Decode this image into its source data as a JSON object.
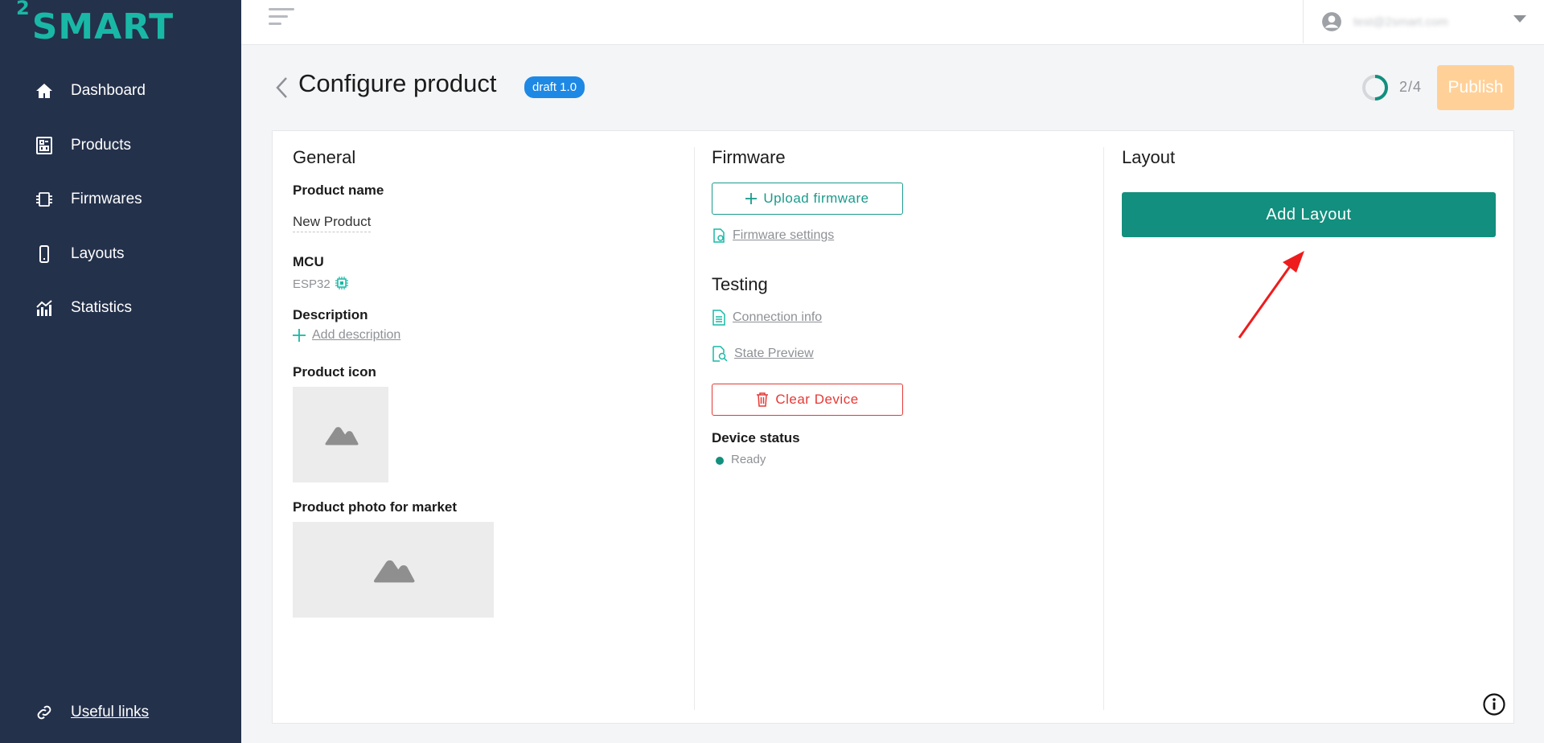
{
  "app": {
    "logo_prefix": "2",
    "logo_text": "SMART"
  },
  "sidebar": {
    "items": [
      {
        "label": "Dashboard",
        "icon": "home-icon"
      },
      {
        "label": "Products",
        "icon": "products-icon"
      },
      {
        "label": "Firmwares",
        "icon": "chip-icon"
      },
      {
        "label": "Layouts",
        "icon": "phone-icon"
      },
      {
        "label": "Statistics",
        "icon": "statistics-icon"
      }
    ],
    "useful_links": "Useful links"
  },
  "topbar": {
    "user_email": "test@2smart.com"
  },
  "header": {
    "title": "Configure product",
    "badge": "draft 1.0",
    "progress_text": "2/4",
    "progress_fraction": 0.5,
    "publish_label": "Publish"
  },
  "general": {
    "title": "General",
    "product_name_label": "Product name",
    "product_name_value": "New Product",
    "mcu_label": "MCU",
    "mcu_value": "ESP32",
    "description_label": "Description",
    "add_description": "Add description",
    "product_icon_label": "Product icon",
    "product_photo_label": "Product photo for market"
  },
  "firmware": {
    "title": "Firmware",
    "upload_label": "Upload firmware",
    "settings_link": "Firmware settings"
  },
  "testing": {
    "title": "Testing",
    "connection_info": "Connection info",
    "state_preview": "State Preview",
    "clear_device": "Clear Device",
    "device_status_label": "Device status",
    "device_status_value": "Ready"
  },
  "layout": {
    "title": "Layout",
    "add_layout_label": "Add Layout"
  },
  "colors": {
    "sidebar_bg": "#24314b",
    "accent_teal": "#128f7e",
    "badge_blue": "#1e88e5",
    "publish_disabled": "#ffd199",
    "danger": "#e53935"
  }
}
